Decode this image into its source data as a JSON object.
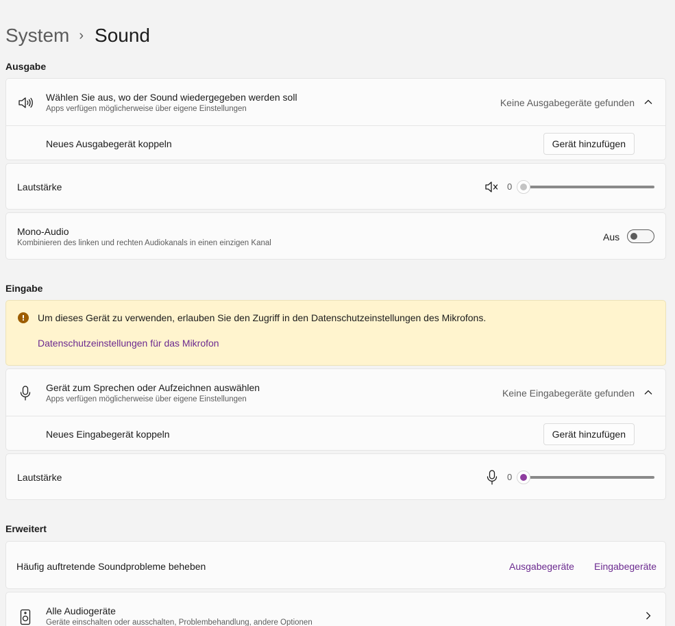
{
  "breadcrumb": {
    "parent": "System",
    "separator": "›",
    "current": "Sound"
  },
  "sections": {
    "output": "Ausgabe",
    "input": "Eingabe",
    "advanced": "Erweitert"
  },
  "output": {
    "device": {
      "title": "Wählen Sie aus, wo der Sound wiedergegeben werden soll",
      "subtitle": "Apps verfügen möglicherweise über eigene Einstellungen",
      "status": "Keine Ausgabegeräte gefunden",
      "icon": "speaker-icon"
    },
    "pair": {
      "label": "Neues Ausgabegerät koppeln",
      "button": "Gerät hinzufügen"
    },
    "volume": {
      "label": "Lautstärke",
      "value": "0",
      "level": 0,
      "icon": "speaker-muted-icon",
      "thumb_color": "#c4c4c4"
    },
    "mono": {
      "title": "Mono-Audio",
      "subtitle": "Kombinieren des linken und rechten Audiokanals in einen einzigen Kanal",
      "state_label": "Aus",
      "on": false
    }
  },
  "input": {
    "warning": {
      "message": "Um dieses Gerät zu verwenden, erlauben Sie den Zugriff in den Datenschutzeinstellungen des Mikrofons.",
      "link": "Datenschutzeinstellungen für das Mikrofon",
      "icon_glyph": "!",
      "color": "#fff4ce"
    },
    "device": {
      "title": "Gerät zum Sprechen oder Aufzeichnen auswählen",
      "subtitle": "Apps verfügen möglicherweise über eigene Einstellungen",
      "status": "Keine Eingabegeräte gefunden",
      "icon": "microphone-icon"
    },
    "pair": {
      "label": "Neues Eingabegerät koppeln",
      "button": "Gerät hinzufügen"
    },
    "volume": {
      "label": "Lautstärke",
      "value": "0",
      "level": 0,
      "icon": "microphone-icon",
      "thumb_color": "#8e3c9f"
    }
  },
  "advanced": {
    "troubleshoot": {
      "label": "Häufig auftretende Soundprobleme beheben",
      "output_link": "Ausgabegeräte",
      "input_link": "Eingabegeräte"
    },
    "all_devices": {
      "title": "Alle Audiogeräte",
      "subtitle": "Geräte einschalten oder ausschalten, Problembehandlung, andere Optionen",
      "icon": "audio-device-icon"
    }
  },
  "colors": {
    "accent": "#6b2a8f",
    "background": "#f3f3f3",
    "card": "#fbfbfb"
  }
}
